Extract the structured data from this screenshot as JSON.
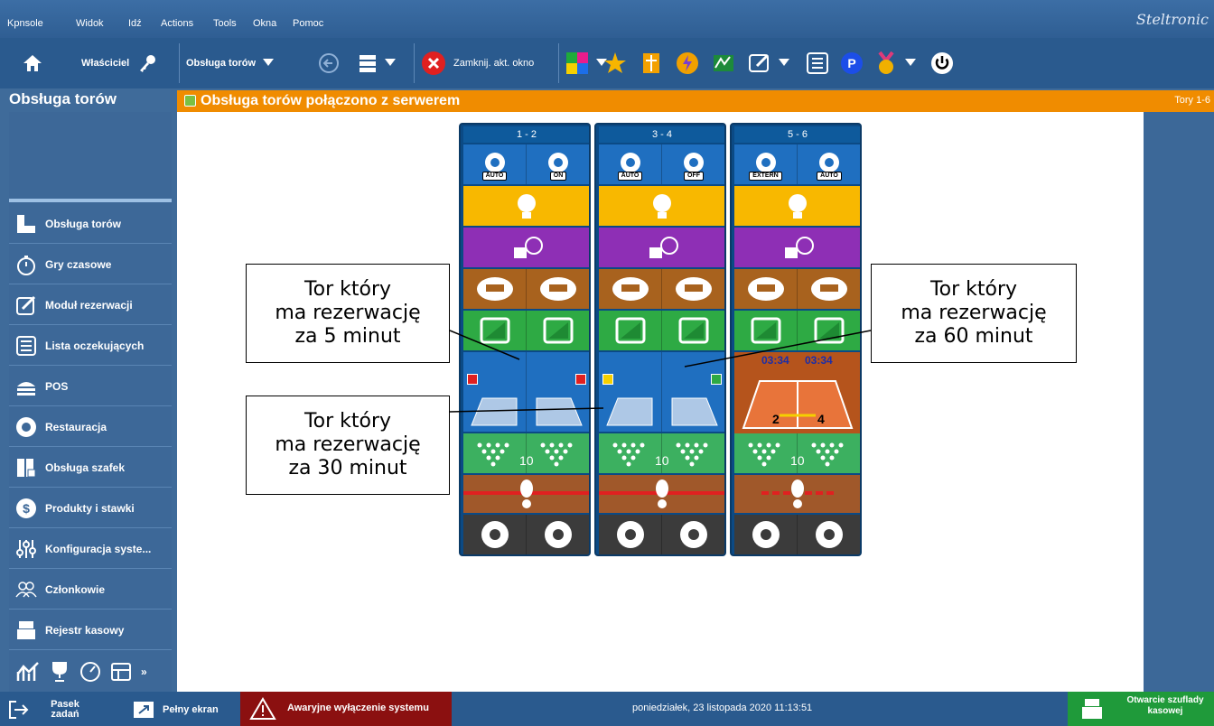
{
  "menu": {
    "items": [
      "Kpnsole",
      "Widok",
      "Idź",
      "Actions",
      "Tools",
      "Okna",
      "Pomoc"
    ],
    "logo": "Steltronic"
  },
  "toolbar": {
    "owner_label": "Właściciel",
    "lanes_label": "Obsługa torów",
    "close_label": "Zamknij. akt. okno"
  },
  "sidebar": {
    "title": "Obsługa torów",
    "items": [
      {
        "label": "Obsługa torów",
        "icon": "lanes-icon"
      },
      {
        "label": "Gry czasowe",
        "icon": "stopwatch-icon"
      },
      {
        "label": "Moduł rezerwacji",
        "icon": "edit-icon"
      },
      {
        "label": "Lista oczekujących",
        "icon": "list-icon"
      },
      {
        "label": "POS",
        "icon": "burger-icon"
      },
      {
        "label": "Restauracja",
        "icon": "restaurant-icon"
      },
      {
        "label": "Obsługa szafek",
        "icon": "locker-icon"
      },
      {
        "label": "Produkty i stawki",
        "icon": "dollar-icon"
      },
      {
        "label": "Konfiguracja syste...",
        "icon": "sliders-icon"
      },
      {
        "label": "Członkowie",
        "icon": "members-icon"
      },
      {
        "label": "Rejestr kasowy",
        "icon": "register-icon"
      }
    ]
  },
  "status": {
    "message": "Obsługa torów połączono z serwerem",
    "right_label": "Tory 1-6"
  },
  "lanes": [
    {
      "pair": "1 - 2",
      "mode_left": "AUTO",
      "mode_right": "ON",
      "score": "10"
    },
    {
      "pair": "3 - 4",
      "mode_left": "AUTO",
      "mode_right": "OFF",
      "score": "10"
    },
    {
      "pair": "5 - 6",
      "mode_left": "EXTERN",
      "mode_right": "AUTO",
      "score": "10",
      "timer_left": "03:34",
      "timer_right": "03:34",
      "player_left": "2",
      "player_right": "4"
    }
  ],
  "callouts": [
    {
      "line1": "Tor który",
      "line2": "ma rezerwację",
      "line3": "za 5 minut"
    },
    {
      "line1": "Tor który",
      "line2": "ma rezerwację",
      "line3": "za 30 minut"
    },
    {
      "line1": "Tor który",
      "line2": "ma rezerwację",
      "line3": "za 60 minut"
    }
  ],
  "footer": {
    "taskbar": "Pasek zadań",
    "fullscreen": "Pełny ekran",
    "emergency": "Awaryjne wyłączenie systemu",
    "datetime": "poniedziałek, 23 listopada 2020 11:13:51",
    "drawer": "Otwarcie szuflady kasowej"
  },
  "colors": {
    "accent": "#f08c00",
    "sidebar": "#3d6898",
    "emergency": "#8b1010",
    "drawer": "#1f9a3a"
  }
}
